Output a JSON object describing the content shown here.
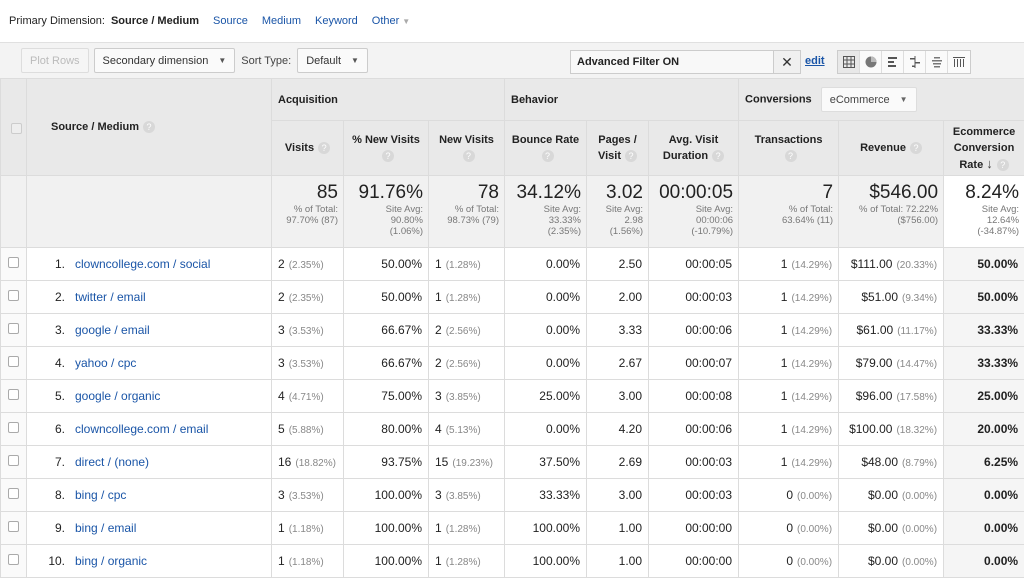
{
  "primary_dimension": {
    "label": "Primary Dimension:",
    "current": "Source / Medium",
    "options": [
      "Source",
      "Medium",
      "Keyword",
      "Other"
    ]
  },
  "toolbar": {
    "plot_rows": "Plot Rows",
    "secondary_dimension": "Secondary dimension",
    "sort_type_label": "Sort Type:",
    "sort_type_value": "Default",
    "filter_text": "Advanced Filter ON",
    "clear_icon": "✕",
    "edit_label": "edit",
    "view_icons": [
      "table-view-icon",
      "pie-view-icon",
      "performance-view-icon",
      "comparison-view-icon",
      "term-cloud-icon",
      "pivot-view-icon"
    ]
  },
  "headers": {
    "dimension": "Source / Medium",
    "groups": {
      "acquisition": "Acquisition",
      "behavior": "Behavior",
      "conversions": "Conversions",
      "conversions_select": "eCommerce"
    },
    "columns": [
      "Visits",
      "% New Visits",
      "New Visits",
      "Bounce Rate",
      "Pages / Visit",
      "Avg. Visit Duration",
      "Transactions",
      "Revenue",
      "Ecommerce Conversion Rate"
    ]
  },
  "summary": {
    "visits": {
      "value": "85",
      "l1": "% of Total:",
      "l2": "97.70% (87)"
    },
    "pct_new": {
      "value": "91.76%",
      "l1": "Site Avg:",
      "l2": "90.80%",
      "l3": "(1.06%)"
    },
    "new_visits": {
      "value": "78",
      "l1": "% of Total:",
      "l2": "98.73% (79)"
    },
    "bounce": {
      "value": "34.12%",
      "l1": "Site Avg:",
      "l2": "33.33%",
      "l3": "(2.35%)"
    },
    "pages": {
      "value": "3.02",
      "l1": "Site Avg:",
      "l2": "2.98",
      "l3": "(1.56%)"
    },
    "duration": {
      "value": "00:00:05",
      "l1": "Site Avg:",
      "l2": "00:00:06",
      "l3": "(-10.79%)"
    },
    "transactions": {
      "value": "7",
      "l1": "% of Total:",
      "l2": "63.64% (11)"
    },
    "revenue": {
      "value": "$546.00",
      "l1": "% of Total: 72.22%",
      "l2": "($756.00)"
    },
    "conv_rate": {
      "value": "8.24%",
      "l1": "Site Avg:",
      "l2": "12.64%",
      "l3": "(-34.87%)"
    }
  },
  "rows": [
    {
      "idx": "1.",
      "name": "clowncollege.com / social",
      "visits": "2",
      "visits_pct": "(2.35%)",
      "pct_new": "50.00%",
      "new": "1",
      "new_pct": "(1.28%)",
      "bounce": "0.00%",
      "pages": "2.50",
      "duration": "00:00:05",
      "tx": "1",
      "tx_pct": "(14.29%)",
      "rev": "$111.00",
      "rev_pct": "(20.33%)",
      "conv": "50.00%"
    },
    {
      "idx": "2.",
      "name": "twitter / email",
      "visits": "2",
      "visits_pct": "(2.35%)",
      "pct_new": "50.00%",
      "new": "1",
      "new_pct": "(1.28%)",
      "bounce": "0.00%",
      "pages": "2.00",
      "duration": "00:00:03",
      "tx": "1",
      "tx_pct": "(14.29%)",
      "rev": "$51.00",
      "rev_pct": "(9.34%)",
      "conv": "50.00%"
    },
    {
      "idx": "3.",
      "name": "google / email",
      "visits": "3",
      "visits_pct": "(3.53%)",
      "pct_new": "66.67%",
      "new": "2",
      "new_pct": "(2.56%)",
      "bounce": "0.00%",
      "pages": "3.33",
      "duration": "00:00:06",
      "tx": "1",
      "tx_pct": "(14.29%)",
      "rev": "$61.00",
      "rev_pct": "(11.17%)",
      "conv": "33.33%"
    },
    {
      "idx": "4.",
      "name": "yahoo / cpc",
      "visits": "3",
      "visits_pct": "(3.53%)",
      "pct_new": "66.67%",
      "new": "2",
      "new_pct": "(2.56%)",
      "bounce": "0.00%",
      "pages": "2.67",
      "duration": "00:00:07",
      "tx": "1",
      "tx_pct": "(14.29%)",
      "rev": "$79.00",
      "rev_pct": "(14.47%)",
      "conv": "33.33%"
    },
    {
      "idx": "5.",
      "name": "google / organic",
      "visits": "4",
      "visits_pct": "(4.71%)",
      "pct_new": "75.00%",
      "new": "3",
      "new_pct": "(3.85%)",
      "bounce": "25.00%",
      "pages": "3.00",
      "duration": "00:00:08",
      "tx": "1",
      "tx_pct": "(14.29%)",
      "rev": "$96.00",
      "rev_pct": "(17.58%)",
      "conv": "25.00%"
    },
    {
      "idx": "6.",
      "name": "clowncollege.com / email",
      "visits": "5",
      "visits_pct": "(5.88%)",
      "pct_new": "80.00%",
      "new": "4",
      "new_pct": "(5.13%)",
      "bounce": "0.00%",
      "pages": "4.20",
      "duration": "00:00:06",
      "tx": "1",
      "tx_pct": "(14.29%)",
      "rev": "$100.00",
      "rev_pct": "(18.32%)",
      "conv": "20.00%"
    },
    {
      "idx": "7.",
      "name": "direct / (none)",
      "visits": "16",
      "visits_pct": "(18.82%)",
      "pct_new": "93.75%",
      "new": "15",
      "new_pct": "(19.23%)",
      "bounce": "37.50%",
      "pages": "2.69",
      "duration": "00:00:03",
      "tx": "1",
      "tx_pct": "(14.29%)",
      "rev": "$48.00",
      "rev_pct": "(8.79%)",
      "conv": "6.25%"
    },
    {
      "idx": "8.",
      "name": "bing / cpc",
      "visits": "3",
      "visits_pct": "(3.53%)",
      "pct_new": "100.00%",
      "new": "3",
      "new_pct": "(3.85%)",
      "bounce": "33.33%",
      "pages": "3.00",
      "duration": "00:00:03",
      "tx": "0",
      "tx_pct": "(0.00%)",
      "rev": "$0.00",
      "rev_pct": "(0.00%)",
      "conv": "0.00%"
    },
    {
      "idx": "9.",
      "name": "bing / email",
      "visits": "1",
      "visits_pct": "(1.18%)",
      "pct_new": "100.00%",
      "new": "1",
      "new_pct": "(1.28%)",
      "bounce": "100.00%",
      "pages": "1.00",
      "duration": "00:00:00",
      "tx": "0",
      "tx_pct": "(0.00%)",
      "rev": "$0.00",
      "rev_pct": "(0.00%)",
      "conv": "0.00%"
    },
    {
      "idx": "10.",
      "name": "bing / organic",
      "visits": "1",
      "visits_pct": "(1.18%)",
      "pct_new": "100.00%",
      "new": "1",
      "new_pct": "(1.28%)",
      "bounce": "100.00%",
      "pages": "1.00",
      "duration": "00:00:00",
      "tx": "0",
      "tx_pct": "(0.00%)",
      "rev": "$0.00",
      "rev_pct": "(0.00%)",
      "conv": "0.00%"
    }
  ]
}
